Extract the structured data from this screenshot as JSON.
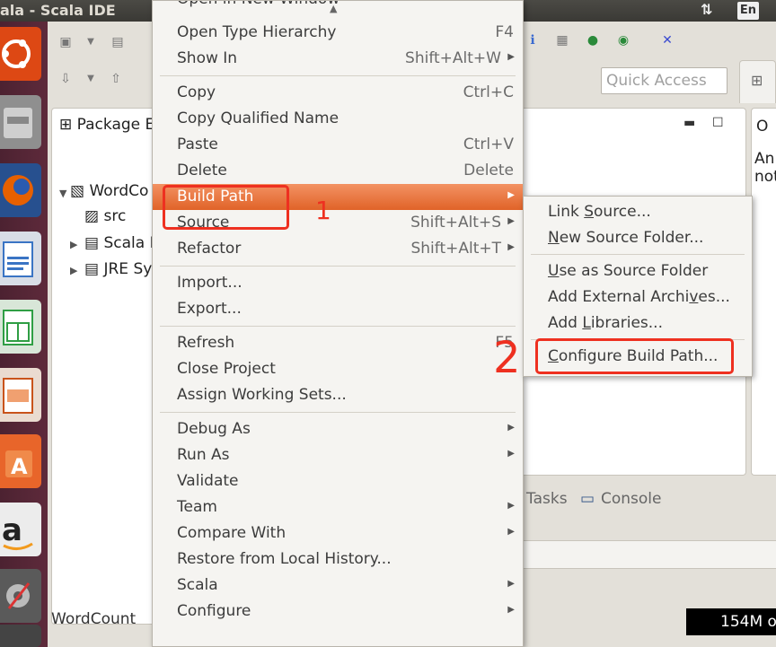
{
  "window": {
    "title": "ala - Scala IDE"
  },
  "indicators": {
    "network": "⇅",
    "language": "En"
  },
  "launcher": [
    {
      "name": "ubuntu-icon",
      "color": "#dd4814"
    },
    {
      "name": "files-icon",
      "color": "#9a9a9a"
    },
    {
      "name": "firefox-icon",
      "color": "#e66000"
    },
    {
      "name": "writer-icon",
      "color": "#3a74c4"
    },
    {
      "name": "calc-icon",
      "color": "#2f9e44"
    },
    {
      "name": "impress-icon",
      "color": "#c9531b"
    },
    {
      "name": "software-center-icon",
      "color": "#e8652a"
    },
    {
      "name": "amazon-icon",
      "color": "#f0f0f0"
    },
    {
      "name": "settings-icon",
      "color": "#8a8a8a"
    },
    {
      "name": "workspace-icon",
      "color": "#5a5a5a"
    }
  ],
  "quick_access": {
    "placeholder": "Quick Access"
  },
  "package_explorer": {
    "title": "Package E",
    "tree": [
      {
        "label": "WordCo",
        "expanded": true
      },
      {
        "label": "src"
      },
      {
        "label": "Scala L"
      },
      {
        "label": "JRE Sy"
      }
    ]
  },
  "outline": {
    "title": "O",
    "lines": [
      "An",
      "not"
    ]
  },
  "bottom_tabs": {
    "tasks": "Tasks",
    "console": "Console"
  },
  "status": {
    "left": "WordCount",
    "heap": "154M o"
  },
  "context_menu": {
    "items": [
      {
        "label": "Open in New Window",
        "cut": true
      },
      {
        "label": "Open Type Hierarchy",
        "accel": "F4"
      },
      {
        "label": "Show In",
        "accel": "Shift+Alt+W",
        "submenu": true
      },
      {
        "sep": true
      },
      {
        "label": "Copy",
        "accel": "Ctrl+C"
      },
      {
        "label": "Copy Qualified Name"
      },
      {
        "label": "Paste",
        "accel": "Ctrl+V"
      },
      {
        "label": "Delete",
        "accel": "Delete"
      },
      {
        "label": "Build Path",
        "submenu": true,
        "selected": true
      },
      {
        "label": "Source",
        "accel": "Shift+Alt+S",
        "submenu": true
      },
      {
        "label": "Refactor",
        "accel": "Shift+Alt+T",
        "submenu": true
      },
      {
        "sep": true
      },
      {
        "label": "Import..."
      },
      {
        "label": "Export..."
      },
      {
        "sep": true
      },
      {
        "label": "Refresh",
        "accel": "F5"
      },
      {
        "label": "Close Project"
      },
      {
        "label": "Assign Working Sets..."
      },
      {
        "sep": true
      },
      {
        "label": "Debug As",
        "submenu": true
      },
      {
        "label": "Run As",
        "submenu": true
      },
      {
        "label": "Validate"
      },
      {
        "label": "Team",
        "submenu": true
      },
      {
        "label": "Compare With",
        "submenu": true
      },
      {
        "label": "Restore from Local History..."
      },
      {
        "label": "Scala",
        "submenu": true
      },
      {
        "label": "Configure",
        "submenu": true
      }
    ]
  },
  "build_path_submenu": {
    "items": [
      {
        "pre": "Link ",
        "mn": "S",
        "post": "ource..."
      },
      {
        "pre": "",
        "mn": "N",
        "post": "ew Source Folder..."
      },
      {
        "sep": true
      },
      {
        "pre": "",
        "mn": "U",
        "post": "se as Source Folder"
      },
      {
        "pre": "Add External Archi",
        "mn": "v",
        "post": "es..."
      },
      {
        "pre": "Add ",
        "mn": "L",
        "post": "ibraries..."
      },
      {
        "sep": true
      },
      {
        "pre": "",
        "mn": "C",
        "post": "onfigure Build Path..."
      }
    ]
  },
  "annotations": {
    "step1": "1",
    "step2": "2",
    "color": "#ee3020"
  },
  "colors": {
    "selection": "#e8733a",
    "menu_bg": "#f5f4f1",
    "launcher": "#5e2a3b"
  }
}
